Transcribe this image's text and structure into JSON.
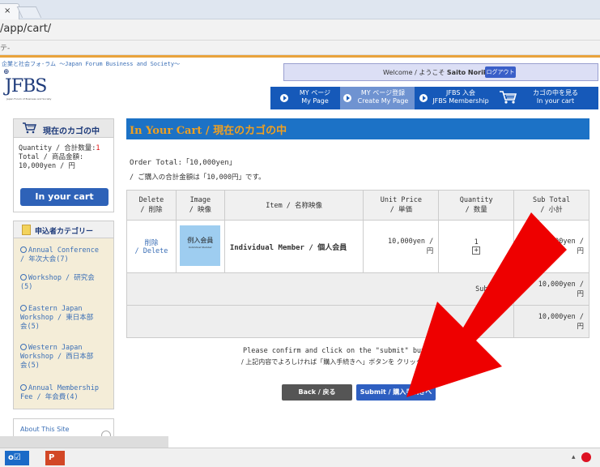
{
  "browser": {
    "tab_close": "×",
    "url": "/app/cart/",
    "bookmark": "テ‐"
  },
  "header": {
    "tagline": "企業と社会フォ‐ラム ～Japan Forum Business and Society～",
    "logo_glyph": "⊕",
    "logo": "JFBS",
    "logo_sub": "Japan Forum of Business and Society",
    "welcome_prefix": "Welcome / ようこそ",
    "welcome_name": "Saito Noriko 様",
    "logout": "ログアウト"
  },
  "nav": {
    "items": [
      {
        "line1": "MY ページ",
        "line2": "My Page"
      },
      {
        "line1": "MY ページ登録",
        "line2": "Create My Page"
      },
      {
        "line1": "JFBS 入会",
        "line2": "JFBS Membership"
      },
      {
        "line1": "カゴの中を見る",
        "line2": "In your cart"
      }
    ]
  },
  "sidebar": {
    "cart_title": "現在のカゴの中",
    "quantity_label": "Quantity / 合計数量:",
    "quantity_value": "1",
    "total_label": "Total / 商品金額:",
    "total_value": "10,000yen / 円",
    "cart_button": "In your cart",
    "category_title": "申込者カテゴリー",
    "categories": [
      {
        "line1": "Annual Conference",
        "line2": "/ 年次大会(7)"
      },
      {
        "line1": "Workshop / 研究会",
        "line2": "(5)"
      },
      {
        "line1": "Eastern Japan",
        "line2": "Workshop / 東日本部",
        "line3": "会(5)"
      },
      {
        "line1": "Western Japan",
        "line2": "Workshop / 西日本部",
        "line3": "会(5)"
      },
      {
        "line1": "Annual Membership",
        "line2": "Fee / 年会費(4)"
      }
    ],
    "about": "About This Site"
  },
  "main": {
    "title": "In Your Cart / 現在のカゴの中",
    "order_total": "Order Total:「10,000yen」",
    "order_total_ja": "/ ご購入の合計金額は「10,000円」です。",
    "table": {
      "headers": [
        {
          "en": "Delete",
          "ja": "/ 削除"
        },
        {
          "en": "Image",
          "ja": "/ 映像"
        },
        {
          "en": "Item / 名称映像",
          "ja": ""
        },
        {
          "en": "Unit Price",
          "ja": "/ 単価"
        },
        {
          "en": "Quantity",
          "ja": "/ 数量"
        },
        {
          "en": "Sub Total",
          "ja": "/ 小計"
        }
      ],
      "row": {
        "delete1": "削除",
        "delete2": "/ Delete",
        "thumb_text": "例入会員",
        "thumb_sub": "Individual Member",
        "item": "Individual Member / 個人会員",
        "unit_price1": "10,000yen /",
        "unit_price2": "円",
        "quantity": "1",
        "plus": "+",
        "subtotal1": "10,000yen /",
        "subtotal2": "円"
      },
      "subtotal_label": "Subtotal",
      "subtotal_value1": "10,000yen /",
      "subtotal_value2": "円",
      "total_value1": "10,000yen /",
      "total_value2": "円"
    },
    "confirm_en": "Please confirm and click on the \"submit\" button.",
    "confirm_ja": "/ 上記内容でよろしければ「購入手続きへ」ボタンを クリックしてください。",
    "back_button": "Back / 戻る",
    "submit_button": "Submit / 購入手続きへ"
  },
  "taskbar": {
    "outlook": "o☑",
    "ppt": "P",
    "tray": "▴"
  },
  "colors": {
    "nav_blue": "#1659b9",
    "title_orange": "#f0a020",
    "arrow_red": "#ee0000"
  }
}
